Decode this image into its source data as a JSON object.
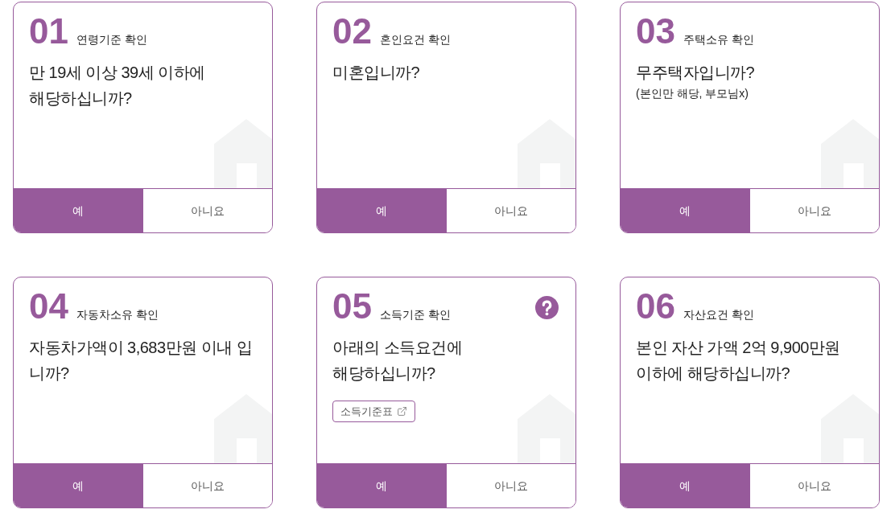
{
  "cards": [
    {
      "number": "01",
      "title": "연령기준 확인",
      "question": [
        "만 19세 이상 39세 이하에",
        "해당하십니까?"
      ],
      "has_help": false,
      "answers": [
        {
          "label": "예",
          "selected": true
        },
        {
          "label": "아니요",
          "selected": false
        }
      ]
    },
    {
      "number": "02",
      "title": "혼인요건 확인",
      "question": [
        "미혼입니까?"
      ],
      "has_help": false,
      "answers": [
        {
          "label": "예",
          "selected": true
        },
        {
          "label": "아니요",
          "selected": false
        }
      ]
    },
    {
      "number": "03",
      "title": "주택소유 확인",
      "question": [
        "무주택자입니까?"
      ],
      "note": "(본인만 해당, 부모님x)",
      "has_help": false,
      "answers": [
        {
          "label": "예",
          "selected": true
        },
        {
          "label": "아니요",
          "selected": false
        }
      ]
    },
    {
      "number": "04",
      "title": "자동차소유 확인",
      "question": [
        "자동차가액이 3,683만원 이내 입",
        "니까?"
      ],
      "has_help": false,
      "answers": [
        {
          "label": "예",
          "selected": true
        },
        {
          "label": "아니요",
          "selected": false
        }
      ]
    },
    {
      "number": "05",
      "title": "소득기준 확인",
      "question": [
        "아래의 소득요건에",
        "해당하십니까?"
      ],
      "link": {
        "label": "소득기준표"
      },
      "has_help": true,
      "answers": [
        {
          "label": "예",
          "selected": true
        },
        {
          "label": "아니요",
          "selected": false
        }
      ]
    },
    {
      "number": "06",
      "title": "자산요건 확인",
      "question": [
        "본인 자산 가액 2억 9,900만원",
        "이하에 해당하십니까?"
      ],
      "has_help": false,
      "answers": [
        {
          "label": "예",
          "selected": true
        },
        {
          "label": "아니요",
          "selected": false
        }
      ]
    }
  ]
}
